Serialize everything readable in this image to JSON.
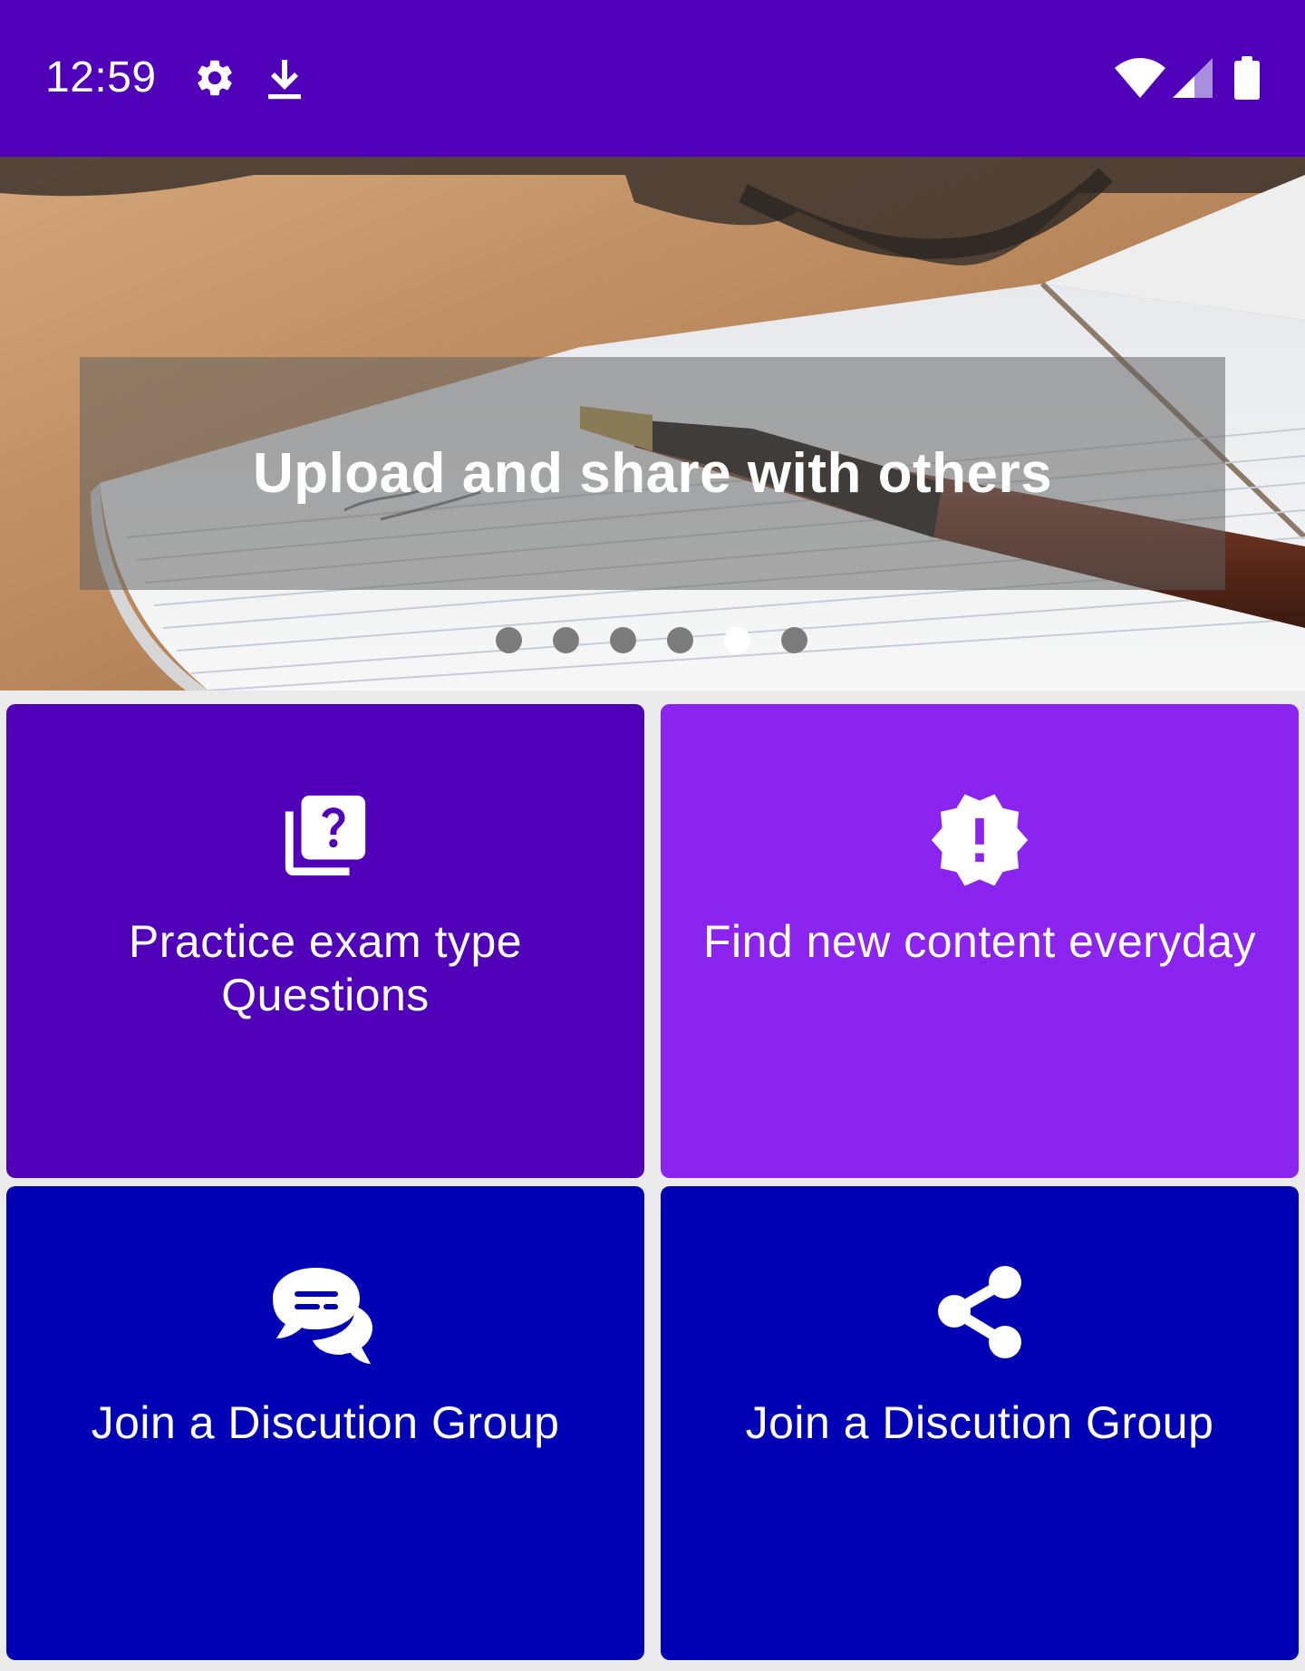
{
  "status_bar": {
    "time": "12:59",
    "icons": [
      "settings-icon",
      "download-icon",
      "wifi-icon",
      "signal-icon",
      "battery-icon"
    ],
    "background": "#4f00b8"
  },
  "banner": {
    "caption": "Upload and share with others",
    "slide_count": 6,
    "active_slide": 5
  },
  "tiles": [
    {
      "label": "Practice exam type Questions",
      "icon": "quiz-icon",
      "color": "#4f00b8"
    },
    {
      "label": "Find new content everyday",
      "icon": "new-releases-icon",
      "color": "#8a24ee"
    },
    {
      "label": "Join a Discution Group",
      "icon": "chat-bubbles-icon",
      "color": "#0000b4"
    },
    {
      "label": "Join a Discution Group",
      "icon": "share-icon",
      "color": "#0000b4"
    }
  ]
}
